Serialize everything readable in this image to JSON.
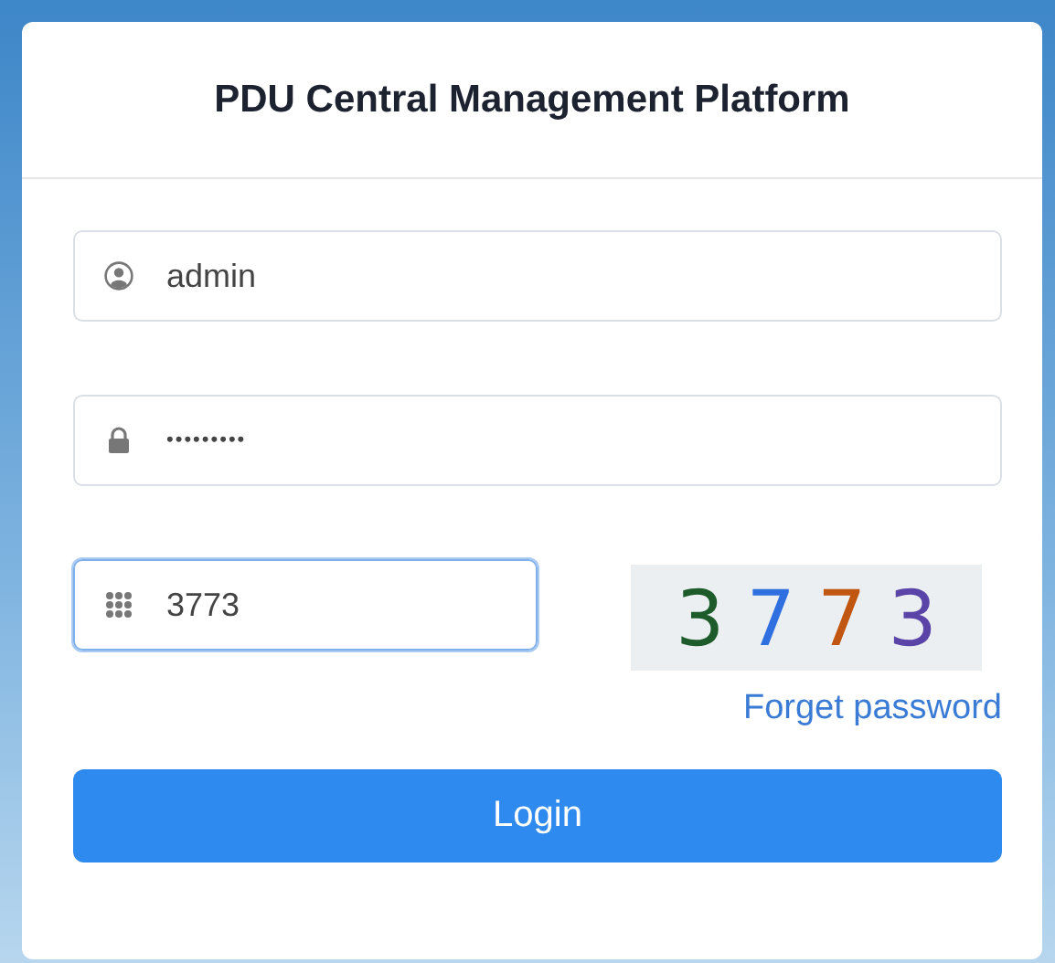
{
  "title": "PDU Central Management Platform",
  "fields": [
    {
      "kind": "user",
      "value": "admin",
      "focused": false
    },
    {
      "kind": "password",
      "value": "•••••••••",
      "focused": false
    }
  ],
  "captcha_field": {
    "value": "3773",
    "focused": true
  },
  "captcha": [
    {
      "char": "3",
      "color": "#1e5b2a"
    },
    {
      "char": "7",
      "color": "#2f6fe0"
    },
    {
      "char": "7",
      "color": "#c0560f"
    },
    {
      "char": "3",
      "color": "#5a44a8"
    }
  ],
  "forgot_link": "Forget password",
  "login_button": "Login"
}
